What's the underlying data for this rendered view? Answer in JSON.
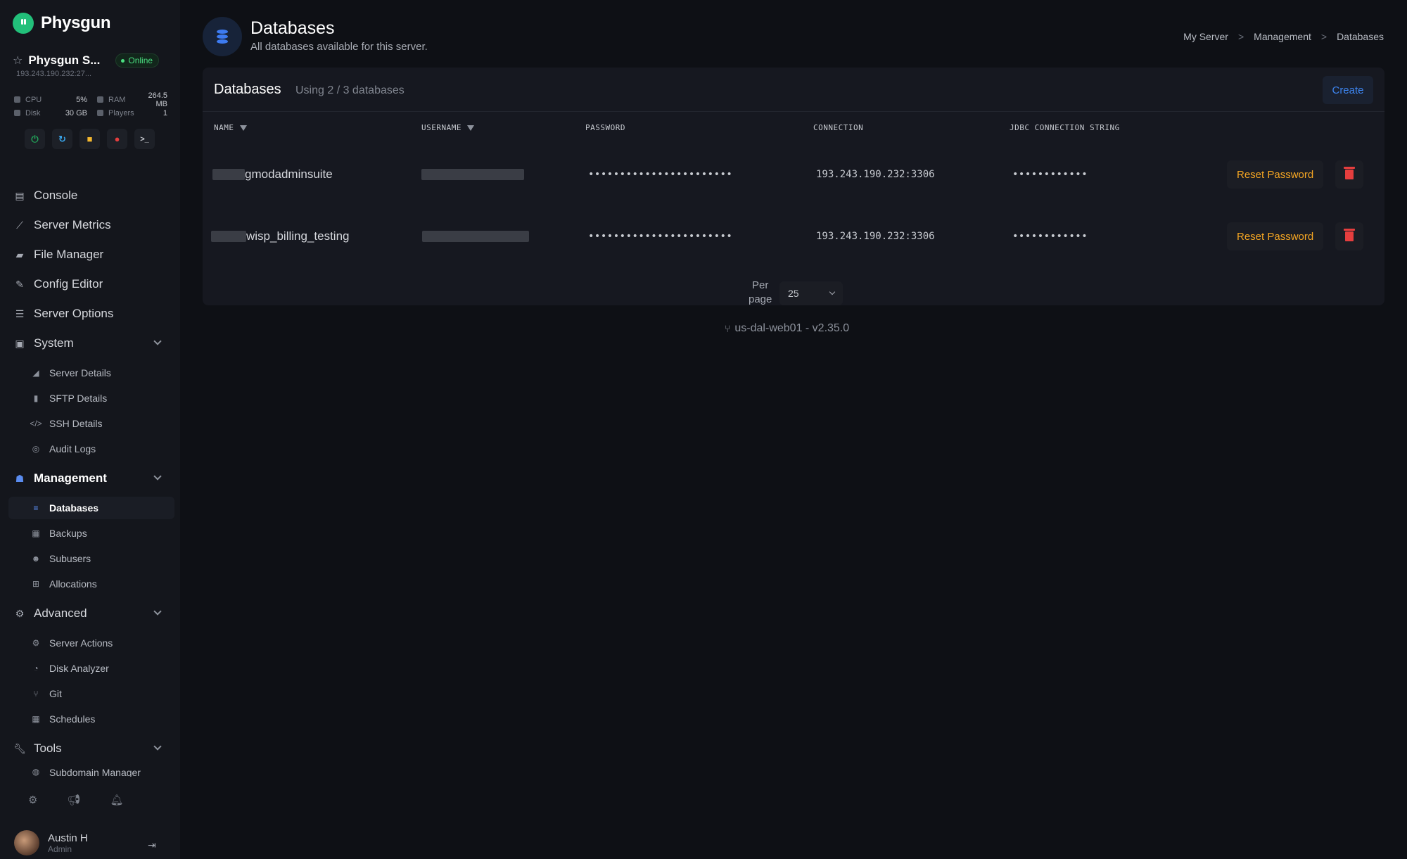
{
  "brand": {
    "name": "Physgun"
  },
  "server": {
    "name": "Physgun S...",
    "status": "Online",
    "ip": "193.243.190.232:27..."
  },
  "stats": {
    "cpu_label": "CPU",
    "cpu_value": "5%",
    "ram_label": "RAM",
    "ram_value": "264.5 MB",
    "disk_label": "Disk",
    "disk_value": "30 GB",
    "players_label": "Players",
    "players_value": "1"
  },
  "power": {
    "console_glyph": ">_"
  },
  "nav": {
    "console": "Console",
    "server_metrics": "Server Metrics",
    "file_manager": "File Manager",
    "config_editor": "Config Editor",
    "server_options": "Server Options",
    "system": "System",
    "system_items": [
      "Server Details",
      "SFTP Details",
      "SSH Details",
      "Audit Logs"
    ],
    "management": "Management",
    "management_items": [
      "Databases",
      "Backups",
      "Subusers",
      "Allocations"
    ],
    "advanced": "Advanced",
    "advanced_items": [
      "Server Actions",
      "Disk Analyzer",
      "Git",
      "Schedules"
    ],
    "tools": "Tools",
    "tools_items": [
      "Subdomain Manager"
    ]
  },
  "user": {
    "name": "Austin H",
    "role": "Admin"
  },
  "page": {
    "title": "Databases",
    "subtitle": "All databases available for this server.",
    "breadcrumbs": [
      "My Server",
      "Management",
      "Databases"
    ]
  },
  "card": {
    "title": "Databases",
    "usage": "Using 2 / 3 databases",
    "create_label": "Create"
  },
  "table": {
    "headers": [
      "NAME",
      "USERNAME",
      "PASSWORD",
      "CONNECTION",
      "JDBC CONNECTION STRING"
    ],
    "rows": [
      {
        "name": "gmodadminsuite",
        "password": "•••••••••••••••••••••••",
        "connection": "193.243.190.232:3306",
        "jdbc": "••••••••••••",
        "reset_label": "Reset Password"
      },
      {
        "name": "wisp_billing_testing",
        "password": "•••••••••••••••••••••••",
        "connection": "193.243.190.232:3306",
        "jdbc": "••••••••••••",
        "reset_label": "Reset Password"
      }
    ]
  },
  "pagination": {
    "per_page_label_1": "Per",
    "per_page_label_2": "page",
    "per_page_value": "25"
  },
  "footer": {
    "version": "us-dal-web01 - v2.35.0"
  },
  "colors": {
    "accent": "#3d85f0",
    "warning": "#f5a623",
    "danger": "#e53e3e",
    "success": "#22c07a"
  }
}
